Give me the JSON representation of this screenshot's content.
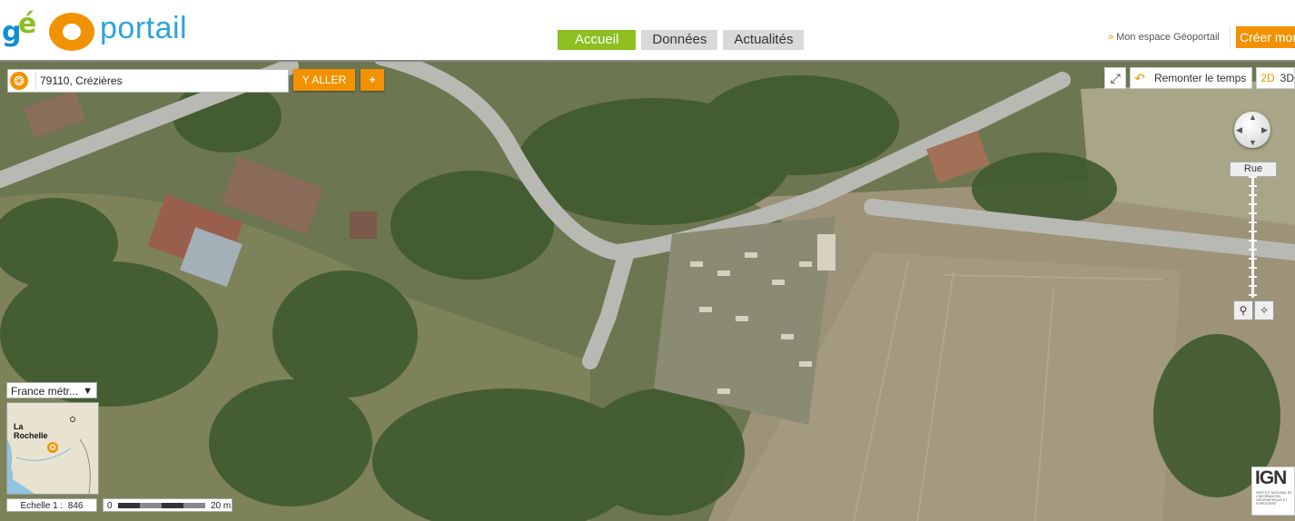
{
  "app": {
    "title": "Géoportail"
  },
  "logo": {
    "g": "g",
    "e": "é",
    "o": "O",
    "rest": "portail"
  },
  "header": {
    "nav": [
      {
        "label": "Accueil",
        "active": true
      },
      {
        "label": "Données",
        "active": false
      },
      {
        "label": "Actualités",
        "active": false
      }
    ],
    "espace_prefix": "»",
    "espace_label": "Mon espace Géoportail",
    "creer_label": "Créer mon"
  },
  "search": {
    "value": "79110, Crézières",
    "go_label": "Y ALLER",
    "add_label": "+"
  },
  "toolbar": {
    "remonter_label": "Remonter le temps",
    "mode_2d": "2D",
    "mode_3d": "3D"
  },
  "nav_controls": {
    "rue_label": "Rue"
  },
  "overview": {
    "territory": "France métr...",
    "city": "La Rochelle"
  },
  "scale": {
    "label": "Echelle 1 :",
    "value": "846",
    "bar_start": "0",
    "bar_end": "20 m"
  },
  "credits": {
    "ign": "IGN",
    "ign_sub": "INSTITUT NATIONAL DE L'INFORMATION GÉOGRAPHIQUE ET FORESTIÈRE"
  },
  "colors": {
    "accent_green": "#8cbf1f",
    "accent_orange": "#f39200",
    "logo_blue": "#2ea3dc"
  }
}
